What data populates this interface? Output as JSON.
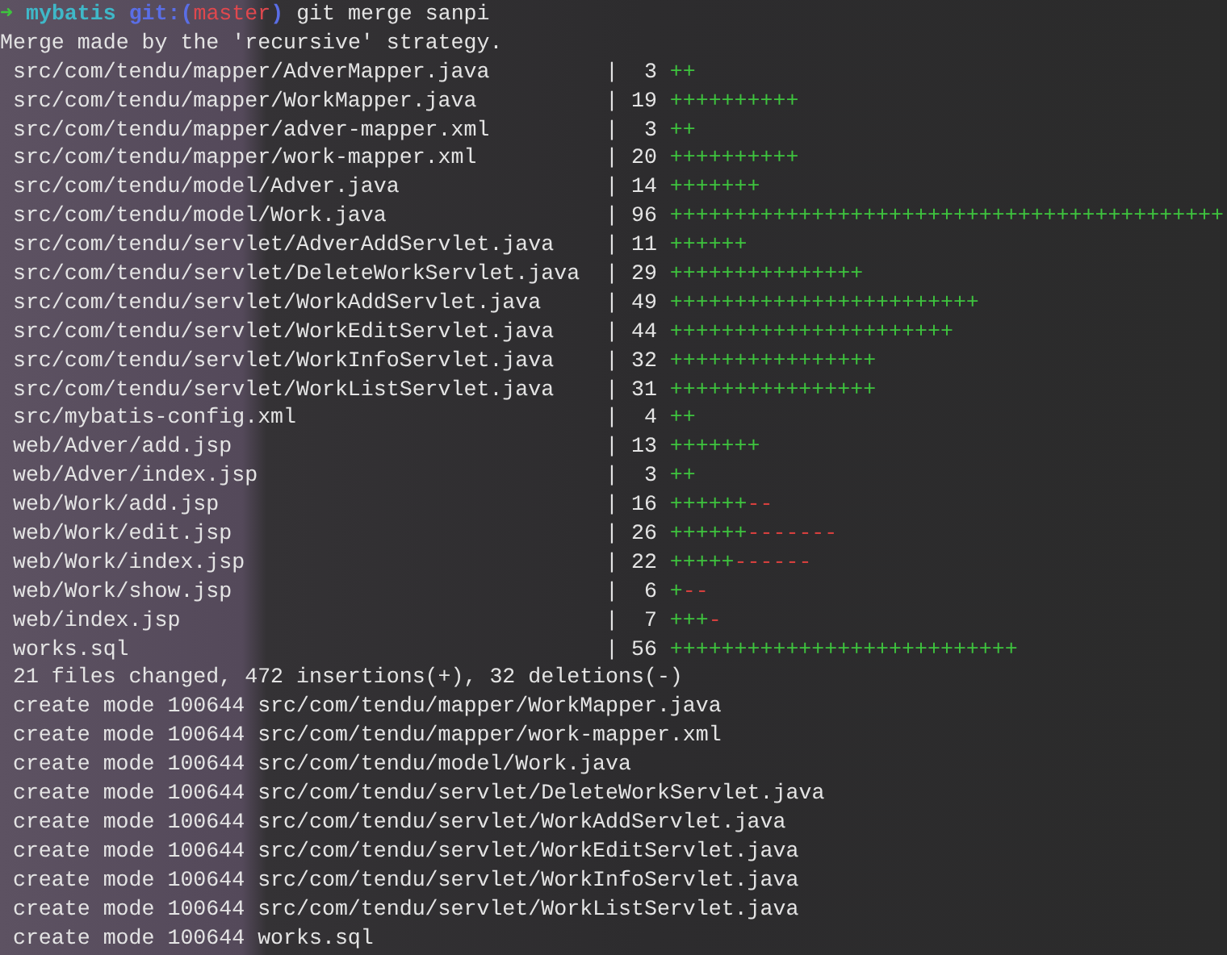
{
  "prompt": {
    "arrow": "➜",
    "directory": "mybatis",
    "git_open": "git:(",
    "branch": "master",
    "git_close": ")",
    "command": "git merge sanpi"
  },
  "message": "Merge made by the 'recursive' strategy.",
  "diffstat": [
    {
      "file": "src/com/tendu/mapper/AdverMapper.java",
      "pipe": "|",
      "count": "3",
      "plus": "++"
    },
    {
      "file": "src/com/tendu/mapper/WorkMapper.java",
      "pipe": "|",
      "count": "19",
      "plus": "++++++++++"
    },
    {
      "file": "src/com/tendu/mapper/adver-mapper.xml",
      "pipe": "|",
      "count": "3",
      "plus": "++"
    },
    {
      "file": "src/com/tendu/mapper/work-mapper.xml",
      "pipe": "|",
      "count": "20",
      "plus": "++++++++++"
    },
    {
      "file": "src/com/tendu/model/Adver.java",
      "pipe": "|",
      "count": "14",
      "plus": "+++++++"
    },
    {
      "file": "src/com/tendu/model/Work.java",
      "pipe": "|",
      "count": "96",
      "plus": "+++++++++++++++++++++++++++++++++++++++++++"
    },
    {
      "file": "src/com/tendu/servlet/AdverAddServlet.java",
      "pipe": "|",
      "count": "11",
      "plus": "++++++"
    },
    {
      "file": "src/com/tendu/servlet/DeleteWorkServlet.java",
      "pipe": "|",
      "count": "29",
      "plus": "+++++++++++++++"
    },
    {
      "file": "src/com/tendu/servlet/WorkAddServlet.java",
      "pipe": "|",
      "count": "49",
      "plus": "++++++++++++++++++++++++"
    },
    {
      "file": "src/com/tendu/servlet/WorkEditServlet.java",
      "pipe": "|",
      "count": "44",
      "plus": "++++++++++++++++++++++"
    },
    {
      "file": "src/com/tendu/servlet/WorkInfoServlet.java",
      "pipe": "|",
      "count": "32",
      "plus": "++++++++++++++++"
    },
    {
      "file": "src/com/tendu/servlet/WorkListServlet.java",
      "pipe": "|",
      "count": "31",
      "plus": "++++++++++++++++"
    },
    {
      "file": "src/mybatis-config.xml",
      "pipe": "|",
      "count": "4",
      "plus": "++"
    },
    {
      "file": "web/Adver/add.jsp",
      "pipe": "|",
      "count": "13",
      "plus": "+++++++"
    },
    {
      "file": "web/Adver/index.jsp",
      "pipe": "|",
      "count": "3",
      "plus": "++"
    },
    {
      "file": "web/Work/add.jsp",
      "pipe": "|",
      "count": "16",
      "plus": "++++++",
      "minus": "--"
    },
    {
      "file": "web/Work/edit.jsp",
      "pipe": "|",
      "count": "26",
      "plus": "++++++",
      "minus": "-------"
    },
    {
      "file": "web/Work/index.jsp",
      "pipe": "|",
      "count": "22",
      "plus": "+++++",
      "minus": "------"
    },
    {
      "file": "web/Work/show.jsp",
      "pipe": "|",
      "count": "6",
      "plus": "+",
      "minus": "--"
    },
    {
      "file": "web/index.jsp",
      "pipe": "|",
      "count": "7",
      "plus": "+++",
      "minus": "-"
    },
    {
      "file": "works.sql",
      "pipe": "|",
      "count": "56",
      "plus": "+++++++++++++++++++++++++++"
    }
  ],
  "summary": "21 files changed, 472 insertions(+), 32 deletions(-)",
  "created": [
    "create mode 100644 src/com/tendu/mapper/WorkMapper.java",
    "create mode 100644 src/com/tendu/mapper/work-mapper.xml",
    "create mode 100644 src/com/tendu/model/Work.java",
    "create mode 100644 src/com/tendu/servlet/DeleteWorkServlet.java",
    "create mode 100644 src/com/tendu/servlet/WorkAddServlet.java",
    "create mode 100644 src/com/tendu/servlet/WorkEditServlet.java",
    "create mode 100644 src/com/tendu/servlet/WorkInfoServlet.java",
    "create mode 100644 src/com/tendu/servlet/WorkListServlet.java",
    "create mode 100644 works.sql"
  ]
}
